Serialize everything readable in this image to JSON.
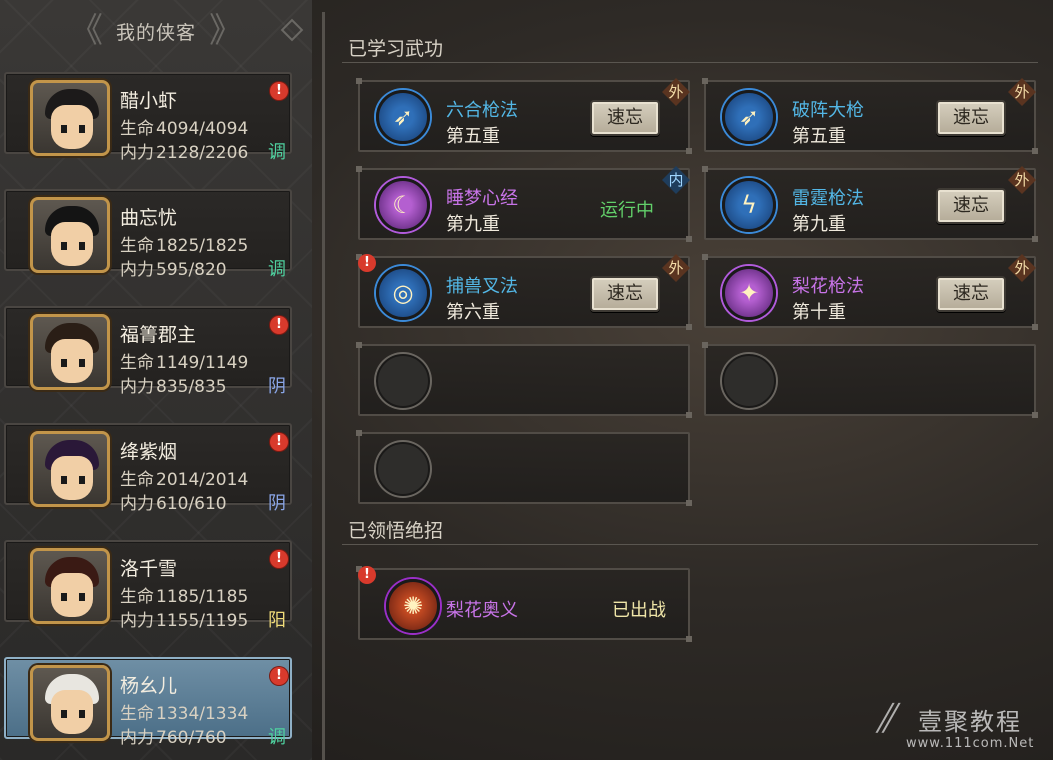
{
  "left_panel": {
    "title": "我的侠客",
    "heroes": [
      {
        "name": "醋小虾",
        "hp_label": "生命",
        "hp": "4094/4094",
        "mp_label": "内力",
        "mp": "2128/2206",
        "type": "调",
        "type_color": "#4fd2a0",
        "alert": "!",
        "active": false,
        "hair": "#1c1a1a"
      },
      {
        "name": "曲忘忧",
        "hp_label": "生命",
        "hp": "1825/1825",
        "mp_label": "内力",
        "mp": "595/820",
        "type": "调",
        "type_color": "#4fd2a0",
        "alert": "",
        "active": false,
        "hair": "#141414"
      },
      {
        "name": "福箐郡主",
        "hp_label": "生命",
        "hp": "1149/1149",
        "mp_label": "内力",
        "mp": "835/835",
        "type": "阴",
        "type_color": "#8aa6e8",
        "alert": "!",
        "active": false,
        "hair": "#2a1e16"
      },
      {
        "name": "绛紫烟",
        "hp_label": "生命",
        "hp": "2014/2014",
        "mp_label": "内力",
        "mp": "610/610",
        "type": "阴",
        "type_color": "#8aa6e8",
        "alert": "!",
        "active": false,
        "hair": "#2a1838"
      },
      {
        "name": "洛千雪",
        "hp_label": "生命",
        "hp": "1185/1185",
        "mp_label": "内力",
        "mp": "1155/1195",
        "type": "阳",
        "type_color": "#f0dc7a",
        "alert": "!",
        "active": false,
        "hair": "#3a1a14"
      },
      {
        "name": "杨幺儿",
        "hp_label": "生命",
        "hp": "1334/1334",
        "mp_label": "内力",
        "mp": "760/760",
        "type": "调",
        "type_color": "#4fd2a0",
        "alert": "!",
        "active": true,
        "hair": "#e8e6e0"
      }
    ]
  },
  "learned_section": {
    "title": "已学习武功",
    "skills": [
      {
        "name": "六合枪法",
        "level": "第五重",
        "icon": "spear-icon",
        "glyph": "➶",
        "color": "blue",
        "action": "速忘",
        "badge": "外",
        "badge_kind": "outer",
        "alert": ""
      },
      {
        "name": "破阵大枪",
        "level": "第五重",
        "icon": "lance-icon",
        "glyph": "➶",
        "color": "blue",
        "action": "速忘",
        "badge": "外",
        "badge_kind": "outer",
        "alert": ""
      },
      {
        "name": "睡梦心经",
        "level": "第九重",
        "icon": "dream-icon",
        "glyph": "☾",
        "color": "purple",
        "status": "运行中",
        "badge": "内",
        "badge_kind": "inner",
        "alert": ""
      },
      {
        "name": "雷霆枪法",
        "level": "第九重",
        "icon": "lightning-icon",
        "glyph": "ϟ",
        "color": "blue",
        "action": "速忘",
        "badge": "外",
        "badge_kind": "outer",
        "alert": ""
      },
      {
        "name": "捕兽叉法",
        "level": "第六重",
        "icon": "whirl-icon",
        "glyph": "◎",
        "color": "blue",
        "action": "速忘",
        "badge": "外",
        "badge_kind": "outer",
        "alert": "!"
      },
      {
        "name": "梨花枪法",
        "level": "第十重",
        "icon": "blossom-spear-icon",
        "glyph": "✦",
        "color": "purple",
        "action": "速忘",
        "badge": "外",
        "badge_kind": "outer",
        "alert": ""
      }
    ]
  },
  "ultimate_section": {
    "title": "已领悟绝招",
    "skill": {
      "name": "梨花奥义",
      "icon": "blossom-burst-icon",
      "glyph": "✺",
      "status": "已出战",
      "alert": "!"
    }
  },
  "watermark": {
    "name": "壹聚教程",
    "url": "www.111com.Net"
  }
}
